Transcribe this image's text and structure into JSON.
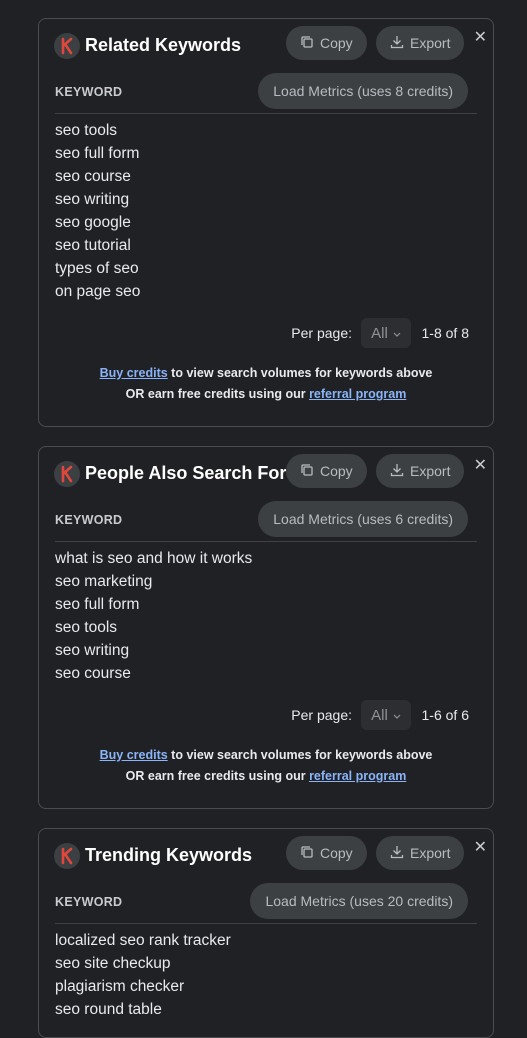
{
  "panels": [
    {
      "title": "Related Keywords",
      "copy_label": "Copy",
      "export_label": "Export",
      "close_label": "✕",
      "column_header": "KEYWORD",
      "load_metrics_label": "Load Metrics (uses 8 credits)",
      "keywords": [
        "seo tools",
        "seo full form",
        "seo course",
        "seo writing",
        "seo google",
        "seo tutorial",
        "types of seo",
        "on page seo"
      ],
      "per_page_label": "Per page:",
      "per_page_value": "All",
      "range": "1-8 of 8",
      "buy_credits_link": "Buy credits",
      "buy_credits_text": " to view search volumes for keywords above",
      "earn_text": "OR earn free credits using our ",
      "referral_link": "referral program"
    },
    {
      "title": "People Also Search For",
      "copy_label": "Copy",
      "export_label": "Export",
      "close_label": "✕",
      "column_header": "KEYWORD",
      "load_metrics_label": "Load Metrics (uses 6 credits)",
      "keywords": [
        "what is seo and how it works",
        "seo marketing",
        "seo full form",
        "seo tools",
        "seo writing",
        "seo course"
      ],
      "per_page_label": "Per page:",
      "per_page_value": "All",
      "range": "1-6 of 6",
      "buy_credits_link": "Buy credits",
      "buy_credits_text": " to view search volumes for keywords above",
      "earn_text": "OR earn free credits using our ",
      "referral_link": "referral program"
    },
    {
      "title": "Trending Keywords",
      "copy_label": "Copy",
      "export_label": "Export",
      "close_label": "✕",
      "column_header": "KEYWORD",
      "load_metrics_label": "Load Metrics (uses 20 credits)",
      "keywords": [
        "localized seo rank tracker",
        "seo site checkup",
        "plagiarism checker",
        "seo round table"
      ]
    }
  ],
  "colors": {
    "background": "#202124",
    "panel_border": "#4a4c50",
    "button_bg": "#3c4043",
    "link": "#8ab4f8",
    "logo_k": "#e0473c"
  },
  "icons": {
    "logo": "k-logo-icon",
    "copy": "copy-icon",
    "export": "download-icon",
    "close": "close-icon",
    "dropdown": "chevron-down-icon"
  }
}
